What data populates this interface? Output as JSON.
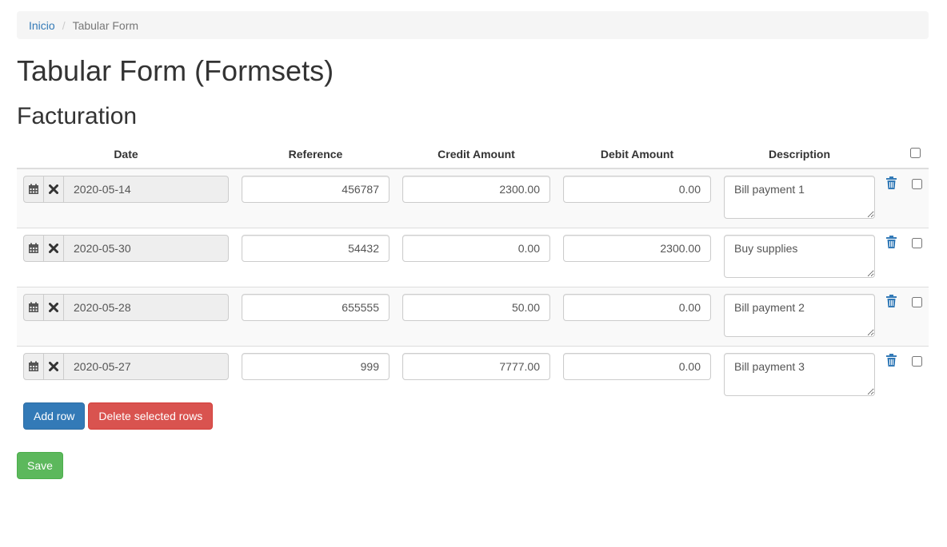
{
  "breadcrumb": {
    "home": "Inicio",
    "separator": "/",
    "current": "Tabular Form"
  },
  "page_title": "Tabular Form (Formsets)",
  "section_title": "Facturation",
  "table": {
    "headers": {
      "date": "Date",
      "reference": "Reference",
      "credit": "Credit Amount",
      "debit": "Debit Amount",
      "description": "Description"
    },
    "rows": [
      {
        "date": "2020-05-14",
        "reference": "456787",
        "credit": "2300.00",
        "debit": "0.00",
        "description": "Bill payment 1"
      },
      {
        "date": "2020-05-30",
        "reference": "54432",
        "credit": "0.00",
        "debit": "2300.00",
        "description": "Buy supplies"
      },
      {
        "date": "2020-05-28",
        "reference": "655555",
        "credit": "50.00",
        "debit": "0.00",
        "description": "Bill payment 2"
      },
      {
        "date": "2020-05-27",
        "reference": "999",
        "credit": "7777.00",
        "debit": "0.00",
        "description": "Bill payment 3"
      }
    ]
  },
  "actions": {
    "add_row": "Add row",
    "delete_selected": "Delete selected rows",
    "save": "Save"
  },
  "colors": {
    "primary": "#337ab7",
    "danger": "#d9534f",
    "success": "#5cb85c",
    "link": "#337ab7"
  },
  "icons": {
    "calendar": "calendar-icon",
    "clear": "clear-icon",
    "delete": "trash-icon"
  }
}
